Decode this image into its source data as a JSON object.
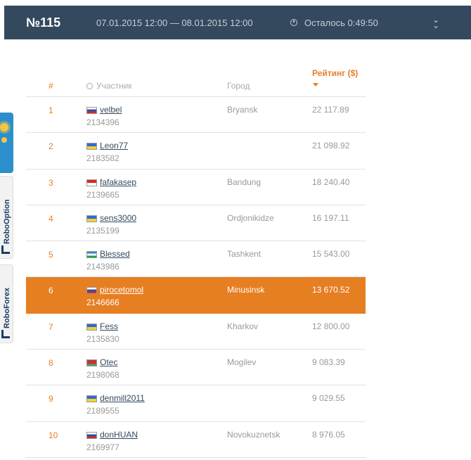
{
  "header": {
    "number": "№115",
    "dates": "07.01.2015 12:00 — 08.01.2015 12:00",
    "remaining": "Осталось 0:49:50"
  },
  "table": {
    "col_num": "#",
    "col_user": "Участник",
    "col_city": "Город",
    "col_rating": "Рейтинг ($)",
    "rows": [
      {
        "rank": "1",
        "flag": "ru",
        "name": "velbel",
        "id": "2134396",
        "city": "Bryansk",
        "score": "22 117.89"
      },
      {
        "rank": "2",
        "flag": "ua",
        "name": "Leon77",
        "id": "2183582",
        "city": "",
        "score": "21 098.92"
      },
      {
        "rank": "3",
        "flag": "id",
        "name": "fafakasep",
        "id": "2139665",
        "city": "Bandung",
        "score": "18 240.40"
      },
      {
        "rank": "4",
        "flag": "ua",
        "name": "sens3000",
        "id": "2135199",
        "city": "Ordjonikidze",
        "score": "16 197.11"
      },
      {
        "rank": "5",
        "flag": "uz",
        "name": "Blessed",
        "id": "2143986",
        "city": "Tashkent",
        "score": "15 543.00"
      },
      {
        "rank": "6",
        "flag": "ru",
        "name": "pirocetomol",
        "id": "2146666",
        "city": "Minusinsk",
        "score": "13 670.52"
      },
      {
        "rank": "7",
        "flag": "ua",
        "name": "Fess",
        "id": "2135830",
        "city": "Kharkov",
        "score": "12 800.00"
      },
      {
        "rank": "8",
        "flag": "by",
        "name": "Otec",
        "id": "2198068",
        "city": "Mogilev",
        "score": "9 083.39"
      },
      {
        "rank": "9",
        "flag": "ua",
        "name": "denmill2011",
        "id": "2189555",
        "city": "",
        "score": "9 029.55"
      },
      {
        "rank": "10",
        "flag": "ru",
        "name": "donHUAN",
        "id": "2169977",
        "city": "Novokuznetsk",
        "score": "8 976.05"
      }
    ]
  },
  "side_tabs": [
    "RoboOption",
    "RoboForex"
  ],
  "colors": {
    "accent": "#e67e22",
    "header_bg": "#34495e",
    "highlight_row": "6"
  }
}
